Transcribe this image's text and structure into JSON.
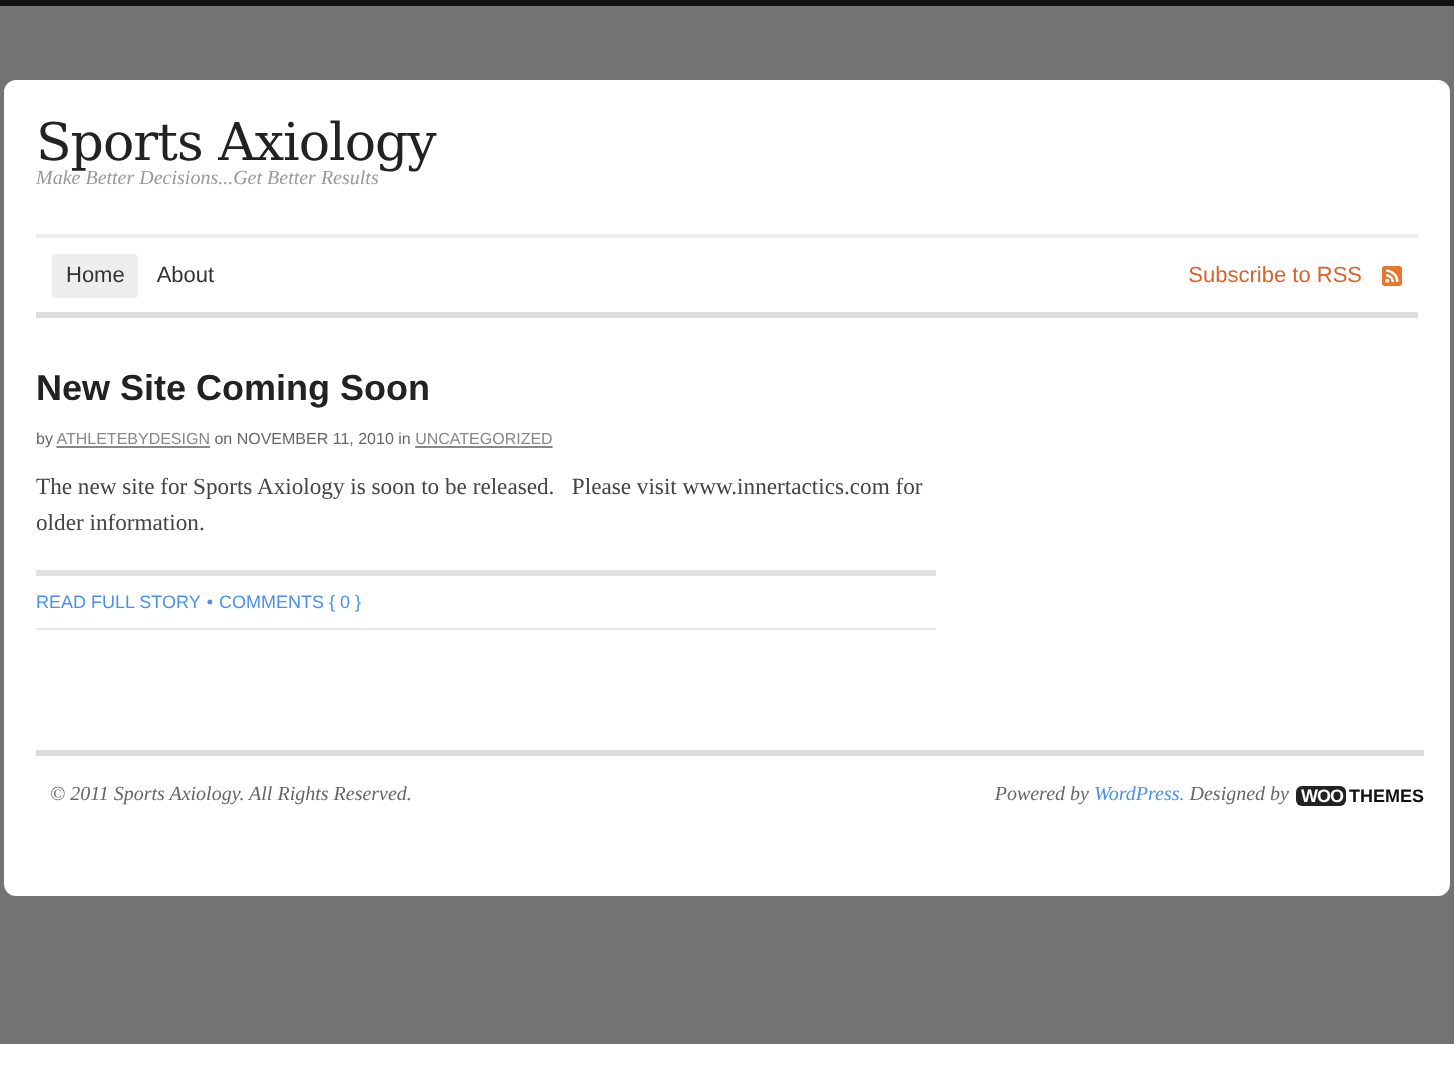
{
  "site": {
    "title": "Sports Axiology",
    "tagline": "Make Better Decisions...Get Better Results"
  },
  "nav": [
    {
      "label": "Home",
      "selected": true
    },
    {
      "label": "About",
      "selected": false
    }
  ],
  "subscribe": "Subscribe to RSS",
  "post": {
    "title": "New Site Coming Soon",
    "meta": {
      "prefix": "by",
      "author": "ATHLETEBYDESIGN",
      "middle": "on NOVEMBER 11, 2010 in",
      "category": "UNCATEGORIZED"
    },
    "body": "The new site for Sports Axiology is soon to be released.   Please visit www.innertactics.com for older information.",
    "read_more": "READ FULL STORY",
    "separator": "•",
    "comments": "COMMENTS { 0 }"
  },
  "footer": {
    "copyright": "© 2011 Sports Axiology. All Rights Reserved.",
    "powered_prefix": "Powered by",
    "powered_link": "WordPress.",
    "designed_by": "Designed by",
    "logo": {
      "part_1": "WOO",
      "part_2": "THEMES"
    }
  }
}
